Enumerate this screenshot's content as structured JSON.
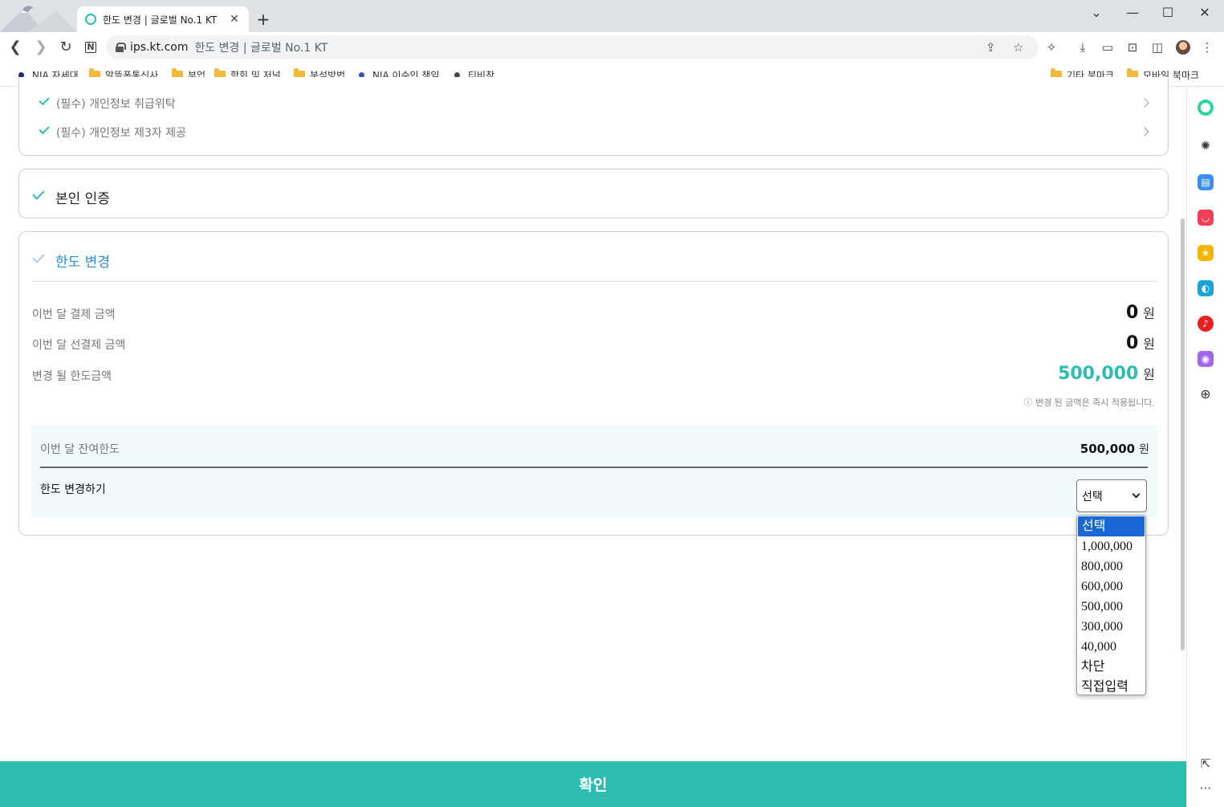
{
  "browser": {
    "tab_title": "한도 변경 | 글로벌 No.1 KT",
    "tab_close": "✕",
    "new_tab": "+",
    "url_host": "ips.kt.com",
    "url_title": "한도 변경 | 글로벌 No.1 KT",
    "bookmarks": [
      {
        "label": "NIA 자세대",
        "kind": "dot",
        "color": "#1a2b6b"
      },
      {
        "label": "알뜰폰통신사",
        "kind": "folder"
      },
      {
        "label": "부업",
        "kind": "folder"
      },
      {
        "label": "학회 및 저널",
        "kind": "folder"
      },
      {
        "label": "분석방법",
        "kind": "folder"
      },
      {
        "label": "NIA 이수인 책임",
        "kind": "dot",
        "color": "#3b4db8"
      },
      {
        "label": "티비착",
        "kind": "dot",
        "color": "#444444"
      }
    ],
    "bookmarks_right": [
      {
        "label": "기타 북마크"
      },
      {
        "label": "모바일 북마크"
      }
    ]
  },
  "terms": {
    "items": [
      {
        "label": "(필수) 개인정보 취급위탁"
      },
      {
        "label": "(필수) 개인정보 제3자 제공"
      }
    ]
  },
  "auth_section": {
    "title": "본인 인증"
  },
  "limit_section": {
    "title": "한도 변경",
    "rows": [
      {
        "label": "이번 달 결제 금액",
        "amount": "0",
        "unit": "원",
        "highlight": false
      },
      {
        "label": "이번 달 선결제 금액",
        "amount": "0",
        "unit": "원",
        "highlight": false
      },
      {
        "label": "변경 될 한도금액",
        "amount": "500,000",
        "unit": "원",
        "highlight": true
      }
    ],
    "note": "ⓘ 변경 된 금액은 즉시 적용됩니다.",
    "remaining_label": "이번 달 잔여한도",
    "remaining_amount": "500,000",
    "remaining_unit": "원",
    "change_label": "한도 변경하기",
    "select_value": "선택",
    "options": [
      "선택",
      "1,000,000",
      "800,000",
      "600,000",
      "500,000",
      "300,000",
      "40,000",
      "차단",
      "직접입력"
    ],
    "selected_index": 0
  },
  "confirm_button": "확인",
  "colors": {
    "accent": "#2ebbb1",
    "title_blue": "#2a8fd6",
    "highlight_amount": "#2ebbb1"
  }
}
